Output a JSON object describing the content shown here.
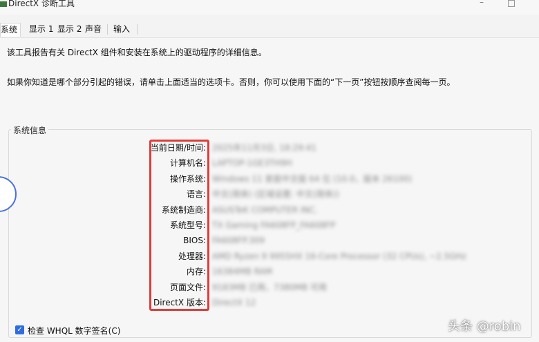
{
  "window": {
    "title": "DirectX 诊断工具",
    "icon": "directx-icon"
  },
  "tabs": [
    {
      "label": "系统",
      "active": true
    },
    {
      "label": "显示 1",
      "active": false
    },
    {
      "label": "显示 2",
      "active": false
    },
    {
      "label": "声音",
      "active": false
    },
    {
      "label": "输入",
      "active": false
    }
  ],
  "intro": {
    "line1": "该工具报告有关 DirectX 组件和安装在系统上的驱动程序的详细信息。",
    "line2": "如果你知道是哪个部分引起的错误，请单击上面适当的选项卡。否则，你可以使用下面的“下一页”按钮按顺序查阅每一页。"
  },
  "system_info": {
    "group_title": "系统信息",
    "rows": [
      {
        "label": "当前日期/时间:",
        "value": "2025年11月3日, 18:29:41"
      },
      {
        "label": "计算机名:",
        "value": "LAPTOP-1GE3TH9H"
      },
      {
        "label": "操作系统:",
        "value": "Windows 11 家庭中文版 64 位 (10.0，版本 26100)"
      },
      {
        "label": "语言:",
        "value": "中文(简体) (区域设置: 中文(简体))"
      },
      {
        "label": "系统制造商:",
        "value": "ASUSTeK COMPUTER INC."
      },
      {
        "label": "系统型号:",
        "value": "TX Gaming FA608FP_FA608FP"
      },
      {
        "label": "BIOS:",
        "value": "FA608FP.309"
      },
      {
        "label": "处理器:",
        "value": "AMD Ryzen 9 9955HX 16-Core Processor            (32 CPUs), ~2.5GHz"
      },
      {
        "label": "内存:",
        "value": "16384MB RAM"
      },
      {
        "label": "页面文件:",
        "value": "9183MB 已用，7380MB 可用"
      },
      {
        "label": "DirectX 版本:",
        "value": "DirectX 12"
      }
    ]
  },
  "whql": {
    "label": "检查 WHQL 数字签名(C)",
    "checked": true
  },
  "watermark": "头条 @robin",
  "colors": {
    "highlight": "#e23b3b",
    "checkbox": "#2f6cdf",
    "circle": "#4a6fd8"
  }
}
